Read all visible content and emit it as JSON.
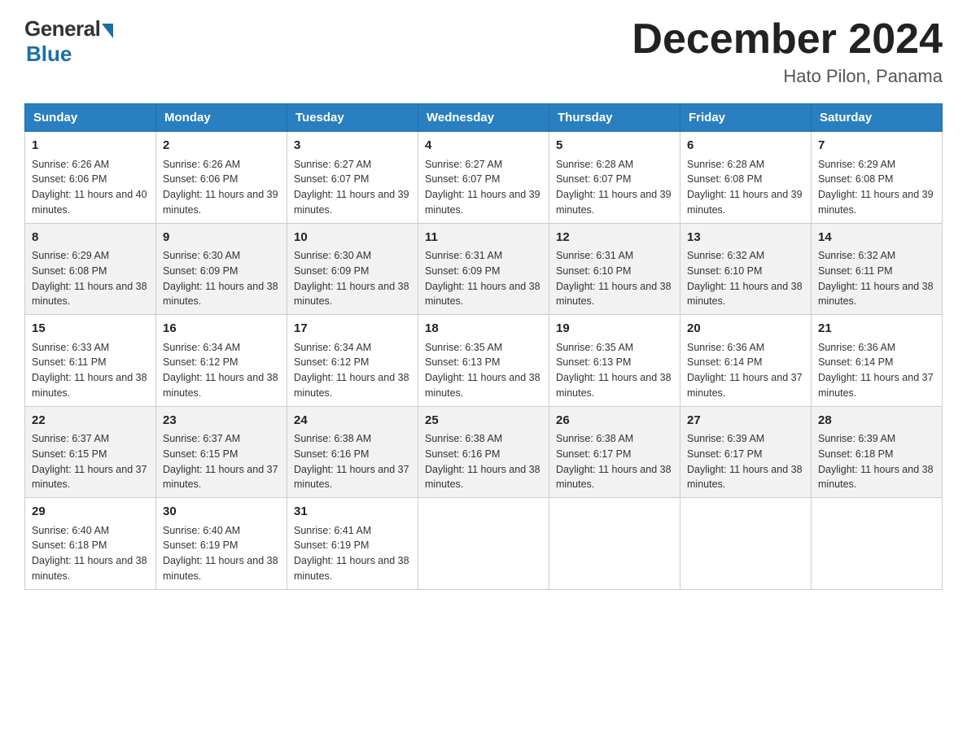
{
  "logo": {
    "general": "General",
    "blue": "Blue"
  },
  "title": "December 2024",
  "location": "Hato Pilon, Panama",
  "days": [
    "Sunday",
    "Monday",
    "Tuesday",
    "Wednesday",
    "Thursday",
    "Friday",
    "Saturday"
  ],
  "weeks": [
    [
      {
        "day": "1",
        "sunrise": "6:26 AM",
        "sunset": "6:06 PM",
        "daylight": "11 hours and 40 minutes."
      },
      {
        "day": "2",
        "sunrise": "6:26 AM",
        "sunset": "6:06 PM",
        "daylight": "11 hours and 39 minutes."
      },
      {
        "day": "3",
        "sunrise": "6:27 AM",
        "sunset": "6:07 PM",
        "daylight": "11 hours and 39 minutes."
      },
      {
        "day": "4",
        "sunrise": "6:27 AM",
        "sunset": "6:07 PM",
        "daylight": "11 hours and 39 minutes."
      },
      {
        "day": "5",
        "sunrise": "6:28 AM",
        "sunset": "6:07 PM",
        "daylight": "11 hours and 39 minutes."
      },
      {
        "day": "6",
        "sunrise": "6:28 AM",
        "sunset": "6:08 PM",
        "daylight": "11 hours and 39 minutes."
      },
      {
        "day": "7",
        "sunrise": "6:29 AM",
        "sunset": "6:08 PM",
        "daylight": "11 hours and 39 minutes."
      }
    ],
    [
      {
        "day": "8",
        "sunrise": "6:29 AM",
        "sunset": "6:08 PM",
        "daylight": "11 hours and 38 minutes."
      },
      {
        "day": "9",
        "sunrise": "6:30 AM",
        "sunset": "6:09 PM",
        "daylight": "11 hours and 38 minutes."
      },
      {
        "day": "10",
        "sunrise": "6:30 AM",
        "sunset": "6:09 PM",
        "daylight": "11 hours and 38 minutes."
      },
      {
        "day": "11",
        "sunrise": "6:31 AM",
        "sunset": "6:09 PM",
        "daylight": "11 hours and 38 minutes."
      },
      {
        "day": "12",
        "sunrise": "6:31 AM",
        "sunset": "6:10 PM",
        "daylight": "11 hours and 38 minutes."
      },
      {
        "day": "13",
        "sunrise": "6:32 AM",
        "sunset": "6:10 PM",
        "daylight": "11 hours and 38 minutes."
      },
      {
        "day": "14",
        "sunrise": "6:32 AM",
        "sunset": "6:11 PM",
        "daylight": "11 hours and 38 minutes."
      }
    ],
    [
      {
        "day": "15",
        "sunrise": "6:33 AM",
        "sunset": "6:11 PM",
        "daylight": "11 hours and 38 minutes."
      },
      {
        "day": "16",
        "sunrise": "6:34 AM",
        "sunset": "6:12 PM",
        "daylight": "11 hours and 38 minutes."
      },
      {
        "day": "17",
        "sunrise": "6:34 AM",
        "sunset": "6:12 PM",
        "daylight": "11 hours and 38 minutes."
      },
      {
        "day": "18",
        "sunrise": "6:35 AM",
        "sunset": "6:13 PM",
        "daylight": "11 hours and 38 minutes."
      },
      {
        "day": "19",
        "sunrise": "6:35 AM",
        "sunset": "6:13 PM",
        "daylight": "11 hours and 38 minutes."
      },
      {
        "day": "20",
        "sunrise": "6:36 AM",
        "sunset": "6:14 PM",
        "daylight": "11 hours and 37 minutes."
      },
      {
        "day": "21",
        "sunrise": "6:36 AM",
        "sunset": "6:14 PM",
        "daylight": "11 hours and 37 minutes."
      }
    ],
    [
      {
        "day": "22",
        "sunrise": "6:37 AM",
        "sunset": "6:15 PM",
        "daylight": "11 hours and 37 minutes."
      },
      {
        "day": "23",
        "sunrise": "6:37 AM",
        "sunset": "6:15 PM",
        "daylight": "11 hours and 37 minutes."
      },
      {
        "day": "24",
        "sunrise": "6:38 AM",
        "sunset": "6:16 PM",
        "daylight": "11 hours and 37 minutes."
      },
      {
        "day": "25",
        "sunrise": "6:38 AM",
        "sunset": "6:16 PM",
        "daylight": "11 hours and 38 minutes."
      },
      {
        "day": "26",
        "sunrise": "6:38 AM",
        "sunset": "6:17 PM",
        "daylight": "11 hours and 38 minutes."
      },
      {
        "day": "27",
        "sunrise": "6:39 AM",
        "sunset": "6:17 PM",
        "daylight": "11 hours and 38 minutes."
      },
      {
        "day": "28",
        "sunrise": "6:39 AM",
        "sunset": "6:18 PM",
        "daylight": "11 hours and 38 minutes."
      }
    ],
    [
      {
        "day": "29",
        "sunrise": "6:40 AM",
        "sunset": "6:18 PM",
        "daylight": "11 hours and 38 minutes."
      },
      {
        "day": "30",
        "sunrise": "6:40 AM",
        "sunset": "6:19 PM",
        "daylight": "11 hours and 38 minutes."
      },
      {
        "day": "31",
        "sunrise": "6:41 AM",
        "sunset": "6:19 PM",
        "daylight": "11 hours and 38 minutes."
      },
      null,
      null,
      null,
      null
    ]
  ]
}
